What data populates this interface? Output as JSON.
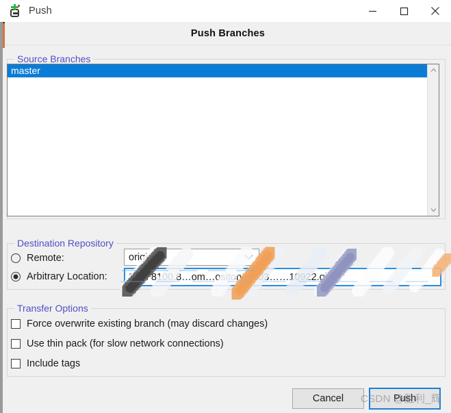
{
  "window": {
    "title": "Push",
    "icon": "git-push-icon",
    "controls": {
      "minimize": "minimize-icon",
      "maximize": "maximize-icon",
      "close": "close-icon"
    }
  },
  "header": {
    "title": "Push Branches"
  },
  "source_branches": {
    "group_label": "Source Branches",
    "items": [
      {
        "label": "master",
        "selected": true
      }
    ],
    "scrollbar": {
      "up_arrow": "chevron-up-icon",
      "down_arrow": "chevron-down-icon"
    }
  },
  "destination_repository": {
    "group_label": "Destination Repository",
    "remote": {
      "label": "Remote:",
      "selected": false,
      "value": "origin",
      "arrow_icon": "chevron-down-icon"
    },
    "arbitrary_location": {
      "label": "Arbitrary Location:",
      "selected": true,
      "value": "10…‘8100.8…om…ository/1603……10922.git",
      "focused": true
    }
  },
  "transfer_options": {
    "group_label": "Transfer Options",
    "items": [
      {
        "label": "Force overwrite existing branch (may discard changes)",
        "checked": false
      },
      {
        "label": "Use thin pack (for slow network connections)",
        "checked": false
      },
      {
        "label": "Include tags",
        "checked": false
      }
    ]
  },
  "footer": {
    "cancel_label": "Cancel",
    "push_label": "Push"
  },
  "watermark": {
    "text": "CSDN @胜利_辉"
  },
  "colors": {
    "selection_blue": "#0b7cd6",
    "focus_blue": "#2a8de0",
    "group_label_purple": "#4f4fc4",
    "dialog_bg": "#f0f0f0",
    "titlebar_bg": "#ffffff"
  }
}
